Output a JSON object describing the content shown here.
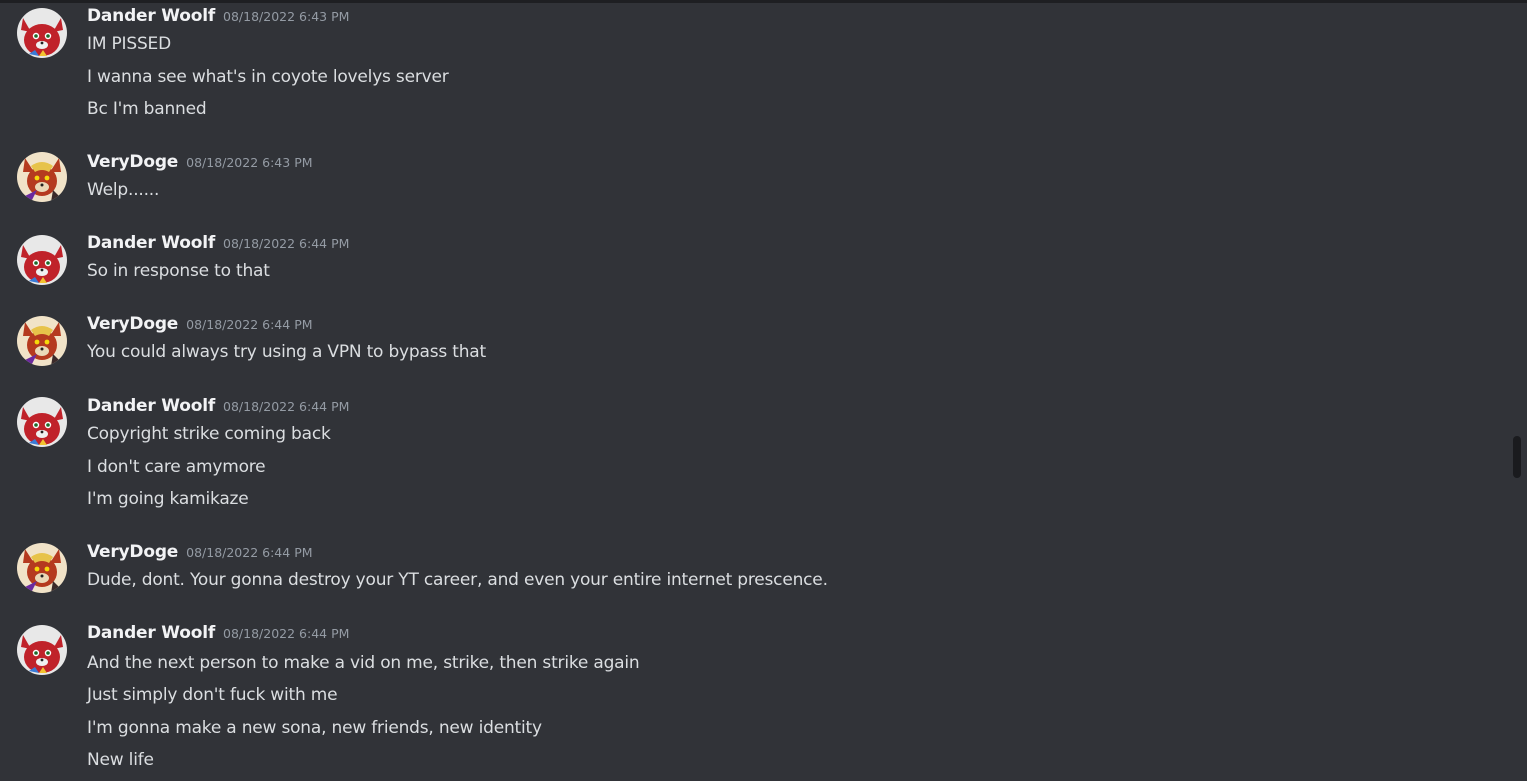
{
  "messages": [
    {
      "author": "Dander Woolf",
      "avatar": "dander-woolf",
      "timestamp": "08/18/2022 6:43 PM",
      "lines": [
        "IM PISSED",
        "I wanna see what's in coyote lovelys server",
        "Bc I'm banned"
      ]
    },
    {
      "author": "VeryDoge",
      "avatar": "verydoge",
      "timestamp": "08/18/2022 6:43 PM",
      "lines": [
        "Welp......"
      ]
    },
    {
      "author": "Dander Woolf",
      "avatar": "dander-woolf",
      "timestamp": "08/18/2022 6:44 PM",
      "lines": [
        "So in response to that"
      ]
    },
    {
      "author": "VeryDoge",
      "avatar": "verydoge",
      "timestamp": "08/18/2022 6:44 PM",
      "lines": [
        "You could always try using a VPN to bypass that"
      ]
    },
    {
      "author": "Dander Woolf",
      "avatar": "dander-woolf",
      "timestamp": "08/18/2022 6:44 PM",
      "lines": [
        "Copyright strike coming back",
        "I don't care amymore",
        "I'm going kamikaze"
      ]
    },
    {
      "author": "VeryDoge",
      "avatar": "verydoge",
      "timestamp": "08/18/2022 6:44 PM",
      "lines": [
        "Dude, dont. Your gonna destroy your YT career, and even your entire internet prescence."
      ]
    },
    {
      "author": "Dander Woolf",
      "avatar": "dander-woolf",
      "timestamp": "08/18/2022 6:44 PM",
      "lines": [
        "And the next person to make a vid on me, strike, then strike again",
        "Just simply don't fuck with me",
        "I'm gonna make a new sona, new friends, new identity",
        "New life"
      ]
    }
  ],
  "colors": {
    "background": "#313338",
    "username": "#f2f3f5",
    "message_text": "#dbdee1",
    "timestamp": "#949ba4"
  }
}
